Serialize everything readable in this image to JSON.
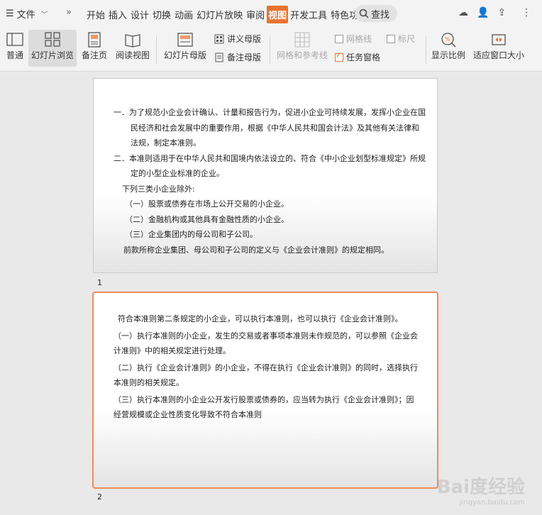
{
  "menubar": {
    "file_label": "文件",
    "tabs": [
      "开始",
      "插入",
      "设计",
      "切换",
      "动画",
      "幻灯片放映",
      "审阅",
      "视图",
      "开发工具",
      "特色功能"
    ],
    "active_tab": "视图",
    "search_label": "查找"
  },
  "ribbon": {
    "normal": "普通",
    "slide_sorter": "幻灯片浏览",
    "notes_page": "备注页",
    "reading_view": "阅读视图",
    "slide_master": "幻灯片母版",
    "handout_master": "讲义母版",
    "notes_master": "备注母版",
    "grid_guides": "网格和参考线",
    "gridlines": "网格线",
    "ruler": "标尺",
    "task_pane": "任务窗格",
    "zoom": "显示比例",
    "fit_window": "适应窗口大小"
  },
  "slides": [
    {
      "number": "1",
      "lines": [
        "一．为了规范小企业会计确认、计量和报告行为，促进小企业可持续发展，发挥小企业在国民经济和社会发展中的重要作用，根据《中华人民共和国会计法》及其他有关法律和法规，制定本准则。",
        "二．本准则适用于在中华人民共和国境内依法设立的、符合《中小企业划型标准规定》所规定的小型企业标准的企业。",
        "下列三类小企业除外:",
        "（一）股票或债券在市场上公开交易的小企业。",
        "（二）金融机构或其他具有金融性质的小企业。",
        "（三）企业集团内的母公司和子公司。",
        "前款所称企业集团、母公司和子公司的定义与《企业会计准则》的规定相同。"
      ]
    },
    {
      "number": "2",
      "lines": [
        "符合本准则第二条规定的小企业，可以执行本准则，也可以执行《企业会计准则》。",
        "（一）执行本准则的小企业，发生的交易或者事项本准则未作规范的，可以参照《企业会计准则》中的相关规定进行处理。",
        "（二）执行《企业会计准则》的小企业，不得在执行《企业会计准则》的同时，选择执行本准则的相关规定。",
        "（三）执行本准则的小企业公开发行股票或债券的，应当转为执行《企业会计准则》；因经营规模或企业性质变化导致不符合本准则"
      ]
    }
  ],
  "watermark": {
    "text": "Bai度经验",
    "sub": "jingyan.baidu.com"
  },
  "colors": {
    "accent": "#e8722f",
    "selected_slide_border": "#f08a5c"
  }
}
